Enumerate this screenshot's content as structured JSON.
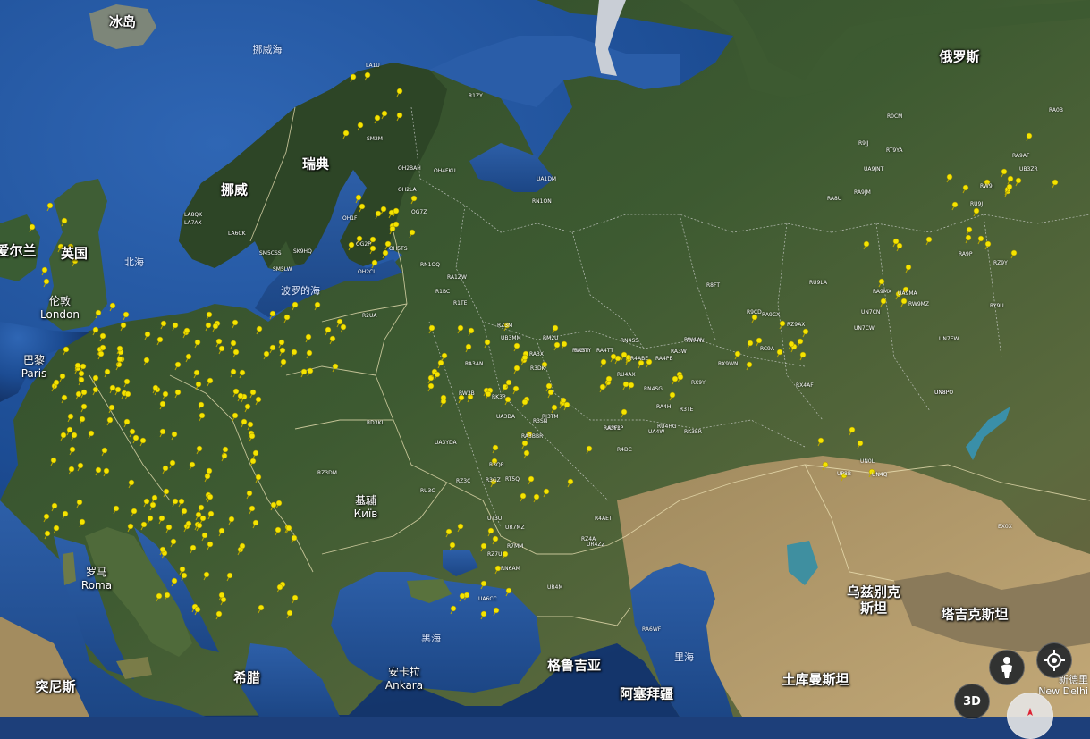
{
  "map": {
    "countries": [
      {
        "id": "iceland",
        "text": "冰岛"
      },
      {
        "id": "russia",
        "text": "俄罗斯"
      },
      {
        "id": "sweden",
        "text": "瑞典"
      },
      {
        "id": "norway",
        "text": "挪威"
      },
      {
        "id": "uk",
        "text": "英国"
      },
      {
        "id": "ireland",
        "text": "爱尔兰"
      },
      {
        "id": "uzbekistan_1",
        "text": "乌兹别克"
      },
      {
        "id": "uzbekistan_2",
        "text": "斯坦"
      },
      {
        "id": "tajikistan",
        "text": "塔吉克斯坦"
      },
      {
        "id": "georgia",
        "text": "格鲁吉亚"
      },
      {
        "id": "azerbaijan",
        "text": "阿塞拜疆"
      },
      {
        "id": "turkmenistan",
        "text": "土库曼斯坦"
      },
      {
        "id": "greece",
        "text": "希腊"
      },
      {
        "id": "tunisia",
        "text": "突尼斯"
      }
    ],
    "seas": [
      {
        "id": "norwegian-sea",
        "text": "挪威海"
      },
      {
        "id": "north-sea",
        "text": "北海"
      },
      {
        "id": "baltic-sea",
        "text": "波罗的海"
      },
      {
        "id": "black-sea",
        "text": "黑海"
      },
      {
        "id": "caspian-sea",
        "text": "里海"
      }
    ],
    "cities": [
      {
        "id": "london",
        "zh": "伦敦",
        "latin": "London"
      },
      {
        "id": "paris",
        "zh": "巴黎",
        "latin": "Paris"
      },
      {
        "id": "kyiv",
        "zh": "基辅",
        "latin": "Київ"
      },
      {
        "id": "rome",
        "zh": "罗马",
        "latin": "Roma"
      },
      {
        "id": "ankara",
        "zh": "安卡拉",
        "latin": "Ankara"
      }
    ],
    "corner": {
      "zh": "新德里",
      "latin": "New Delhi"
    },
    "pin_color": "#f5e400",
    "pin_labels": [
      "LA1U",
      "R1ZY",
      "SM2M",
      "OH2BAH",
      "OH4FKU",
      "UA1DM",
      "RN1ON",
      "LA8QK",
      "LA7AX",
      "LA6CK",
      "SM5CSS",
      "SK9HQ",
      "SM5LW",
      "OH1F",
      "OG2P",
      "OH5TS",
      "OH2LA",
      "OG7Z",
      "OH2CI",
      "RN1OQ",
      "RA1ZW",
      "R1BC",
      "RZ3M",
      "RM2U",
      "RA3TT",
      "RN4SS",
      "RW4W",
      "R8FT",
      "RU9LA",
      "RA9MX",
      "UA9MA",
      "RW9MZ",
      "UN7CN",
      "UN7CW",
      "RA9CX",
      "RZ9AX",
      "R9CD",
      "RC9A",
      "RX9WN",
      "RX4AF",
      "RK3P",
      "RA3X",
      "R3DK",
      "RN6AM",
      "UT3U",
      "UR7MZ",
      "R4AET",
      "RZ4A",
      "RA6WF",
      "UA6CC",
      "UR4M",
      "RA4TT",
      "RU4AX",
      "R4ABE",
      "RN4SG",
      "RW4W",
      "RA4PB",
      "RX9Y",
      "RA4H",
      "RU4HG",
      "UN8P",
      "UN0L",
      "UP8B",
      "UN4Q",
      "EX0X",
      "RA0B",
      "R0CM",
      "R9JJ",
      "RT9YA",
      "UA9JNT",
      "RA8U",
      "RA9JM",
      "RA9AF",
      "UB3ZR",
      "RW9J",
      "RU9J",
      "RA9P",
      "RZ9Y",
      "RY9U",
      "UN7EW",
      "UN8PO",
      "R1TE",
      "R2UA",
      "RZ7U",
      "R7MM",
      "RJ3TM",
      "UA3DA",
      "R3SN",
      "RA3BBR",
      "RU3C",
      "RZ3DM",
      "UA3YDA",
      "R3QR",
      "RT5Q",
      "UB3MM",
      "R3GZ",
      "RA3TY",
      "RZ3C",
      "RA3AN",
      "RW3B",
      "UR4ZZ",
      "UA4W",
      "RA3W",
      "R3TE",
      "RD3KL",
      "RW3P",
      "RA3FL",
      "RK3ER",
      "UA4G",
      "R4DC"
    ]
  },
  "controls": {
    "pegman": "pegman-icon",
    "locate": "locate-icon",
    "three_d": "3D"
  }
}
